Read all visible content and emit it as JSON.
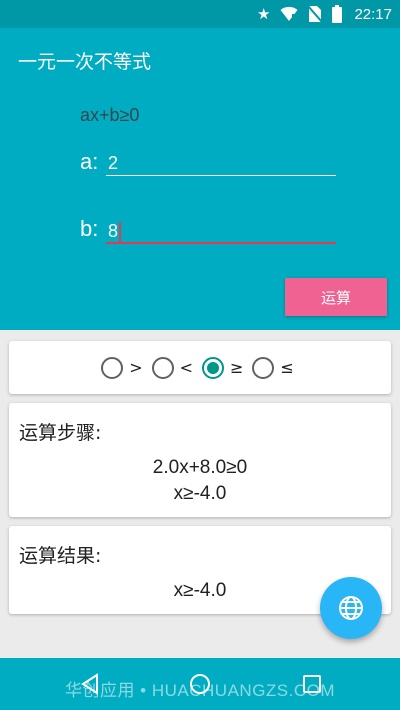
{
  "statusbar": {
    "time": "22:17"
  },
  "appbar": {
    "title": "一元一次不等式"
  },
  "form": {
    "formula": "ax+b≥0",
    "a_label": "a:",
    "a_value": "2",
    "b_label": "b:",
    "b_value": "8",
    "calc_button": "运算"
  },
  "operators": [
    {
      "symbol": ">",
      "checked": false
    },
    {
      "symbol": "<",
      "checked": false
    },
    {
      "symbol": "≥",
      "checked": true
    },
    {
      "symbol": "≤",
      "checked": false
    }
  ],
  "steps": {
    "heading": "运算步骤:",
    "lines": [
      "2.0x+8.0≥0",
      "x≥-4.0"
    ]
  },
  "result": {
    "heading": "运算结果:",
    "value": "x≥-4.0"
  },
  "watermark": "华创应用 • HUACHUANGZS.COM",
  "colors": {
    "primary": "#00acc1",
    "accent": "#f06292",
    "fab": "#29b6f6",
    "radio_checked": "#009688"
  },
  "icons": [
    "star-icon",
    "wifi-icon",
    "no-sim-icon",
    "battery-icon",
    "globe-icon",
    "back-icon",
    "home-icon",
    "recents-icon"
  ]
}
